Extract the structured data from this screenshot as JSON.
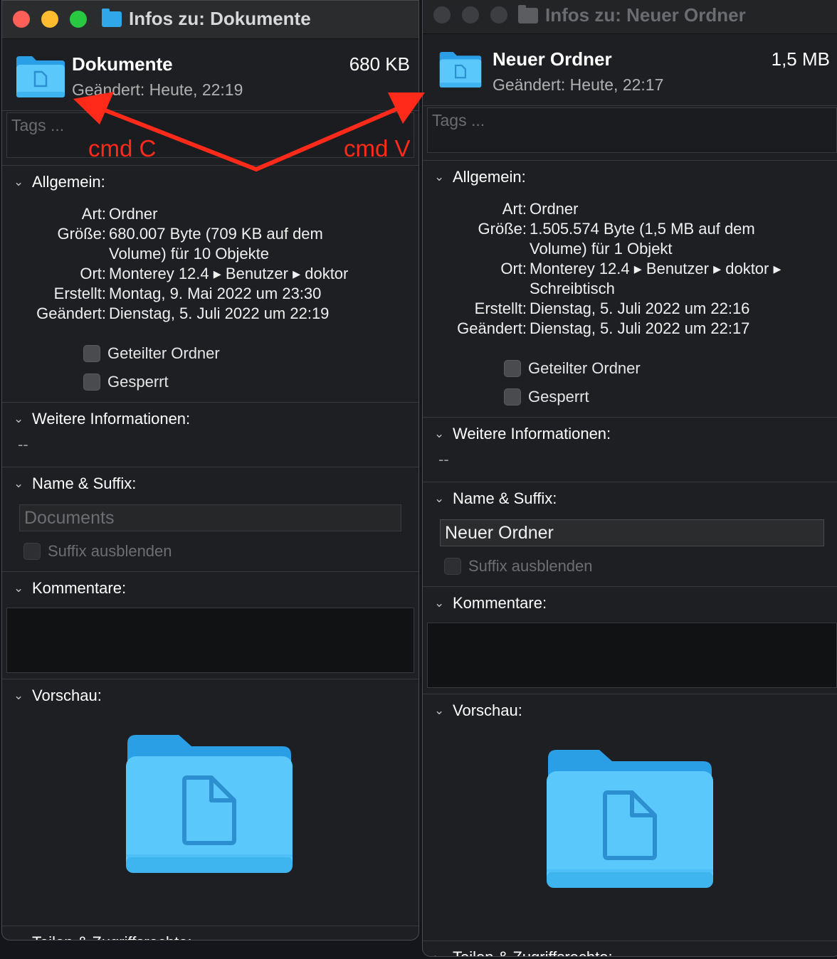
{
  "left": {
    "window_title": "Infos zu: Dokumente",
    "file_name": "Dokumente",
    "modified_short": "Geändert: Heute, 22:19",
    "size": "680 KB",
    "tags_placeholder": "Tags ...",
    "general": {
      "header": "Allgemein:",
      "rows": [
        {
          "label": "Art:",
          "value": "Ordner"
        },
        {
          "label": "Größe:",
          "value": "680.007 Byte (709 KB auf dem Volume) für 10 Objekte"
        },
        {
          "label": "Ort:",
          "value": "Monterey 12.4 ▸ Benutzer ▸ doktor"
        },
        {
          "label": "Erstellt:",
          "value": "Montag, 9. Mai 2022 um 23:30"
        },
        {
          "label": "Geändert:",
          "value": "Dienstag, 5. Juli 2022 um 22:19"
        }
      ],
      "shared_folder": "Geteilter Ordner",
      "locked": "Gesperrt"
    },
    "more_info": {
      "header": "Weitere Informationen:",
      "value": "--"
    },
    "name_suffix": {
      "header": "Name & Suffix:",
      "name_value": "Documents",
      "hide_suffix": "Suffix ausblenden"
    },
    "comments": {
      "header": "Kommentare:"
    },
    "preview": {
      "header": "Vorschau:"
    },
    "sharing": {
      "header": "Teilen & Zugriffsrechte:"
    }
  },
  "right": {
    "window_title": "Infos zu: Neuer Ordner",
    "file_name": "Neuer Ordner",
    "modified_short": "Geändert: Heute, 22:17",
    "size": "1,5 MB",
    "tags_placeholder": "Tags ...",
    "general": {
      "header": "Allgemein:",
      "rows": [
        {
          "label": "Art:",
          "value": "Ordner"
        },
        {
          "label": "Größe:",
          "value": "1.505.574 Byte (1,5 MB auf dem Volume) für 1 Objekt"
        },
        {
          "label": "Ort:",
          "value": "Monterey 12.4 ▸ Benutzer ▸ doktor ▸ Schreibtisch"
        },
        {
          "label": "Erstellt:",
          "value": "Dienstag, 5. Juli 2022 um 22:16"
        },
        {
          "label": "Geändert:",
          "value": "Dienstag, 5. Juli 2022 um 22:17"
        }
      ],
      "shared_folder": "Geteilter Ordner",
      "locked": "Gesperrt"
    },
    "more_info": {
      "header": "Weitere Informationen:",
      "value": "--"
    },
    "name_suffix": {
      "header": "Name & Suffix:",
      "name_value": "Neuer Ordner",
      "hide_suffix": "Suffix ausblenden"
    },
    "comments": {
      "header": "Kommentare:"
    },
    "preview": {
      "header": "Vorschau:"
    },
    "sharing": {
      "header": "Teilen & Zugriffsrechte:"
    }
  },
  "annotation": {
    "copy_label": "cmd C",
    "paste_label": "cmd V",
    "color": "#ff2a1a"
  },
  "colors": {
    "folder_light": "#5ac8fa",
    "folder_dark": "#2b9fe6",
    "close": "#fe5f57",
    "minimize": "#febc2e",
    "zoom": "#28c840"
  }
}
